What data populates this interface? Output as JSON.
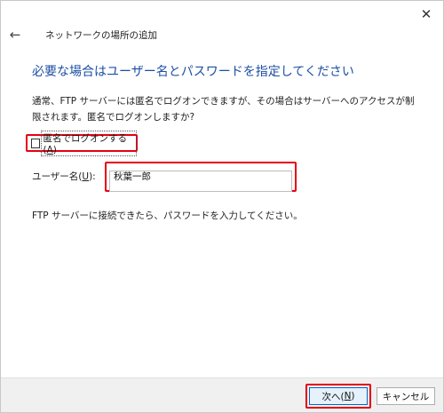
{
  "window": {
    "close_label": "✕",
    "back_label": "←",
    "title": "ネットワークの場所の追加"
  },
  "content": {
    "heading": "必要な場合はユーザー名とパスワードを指定してください",
    "description": "通常、FTP サーバーには匿名でログオンできますが、その場合はサーバーへのアクセスが制限されます。匿名でログオンしますか?",
    "anonymous_checkbox": {
      "label_prefix": "匿名でログオンする(",
      "label_key": "A",
      "label_suffix": ")",
      "checked": false
    },
    "username": {
      "label_prefix": "ユーザー名(",
      "label_key": "U",
      "label_suffix": "):",
      "value": "秋葉一郎"
    },
    "info_text": "FTP サーバーに接続できたら、パスワードを入力してください。"
  },
  "footer": {
    "next_prefix": "次へ(",
    "next_key": "N",
    "next_suffix": ")",
    "cancel_label": "キャンセル"
  }
}
